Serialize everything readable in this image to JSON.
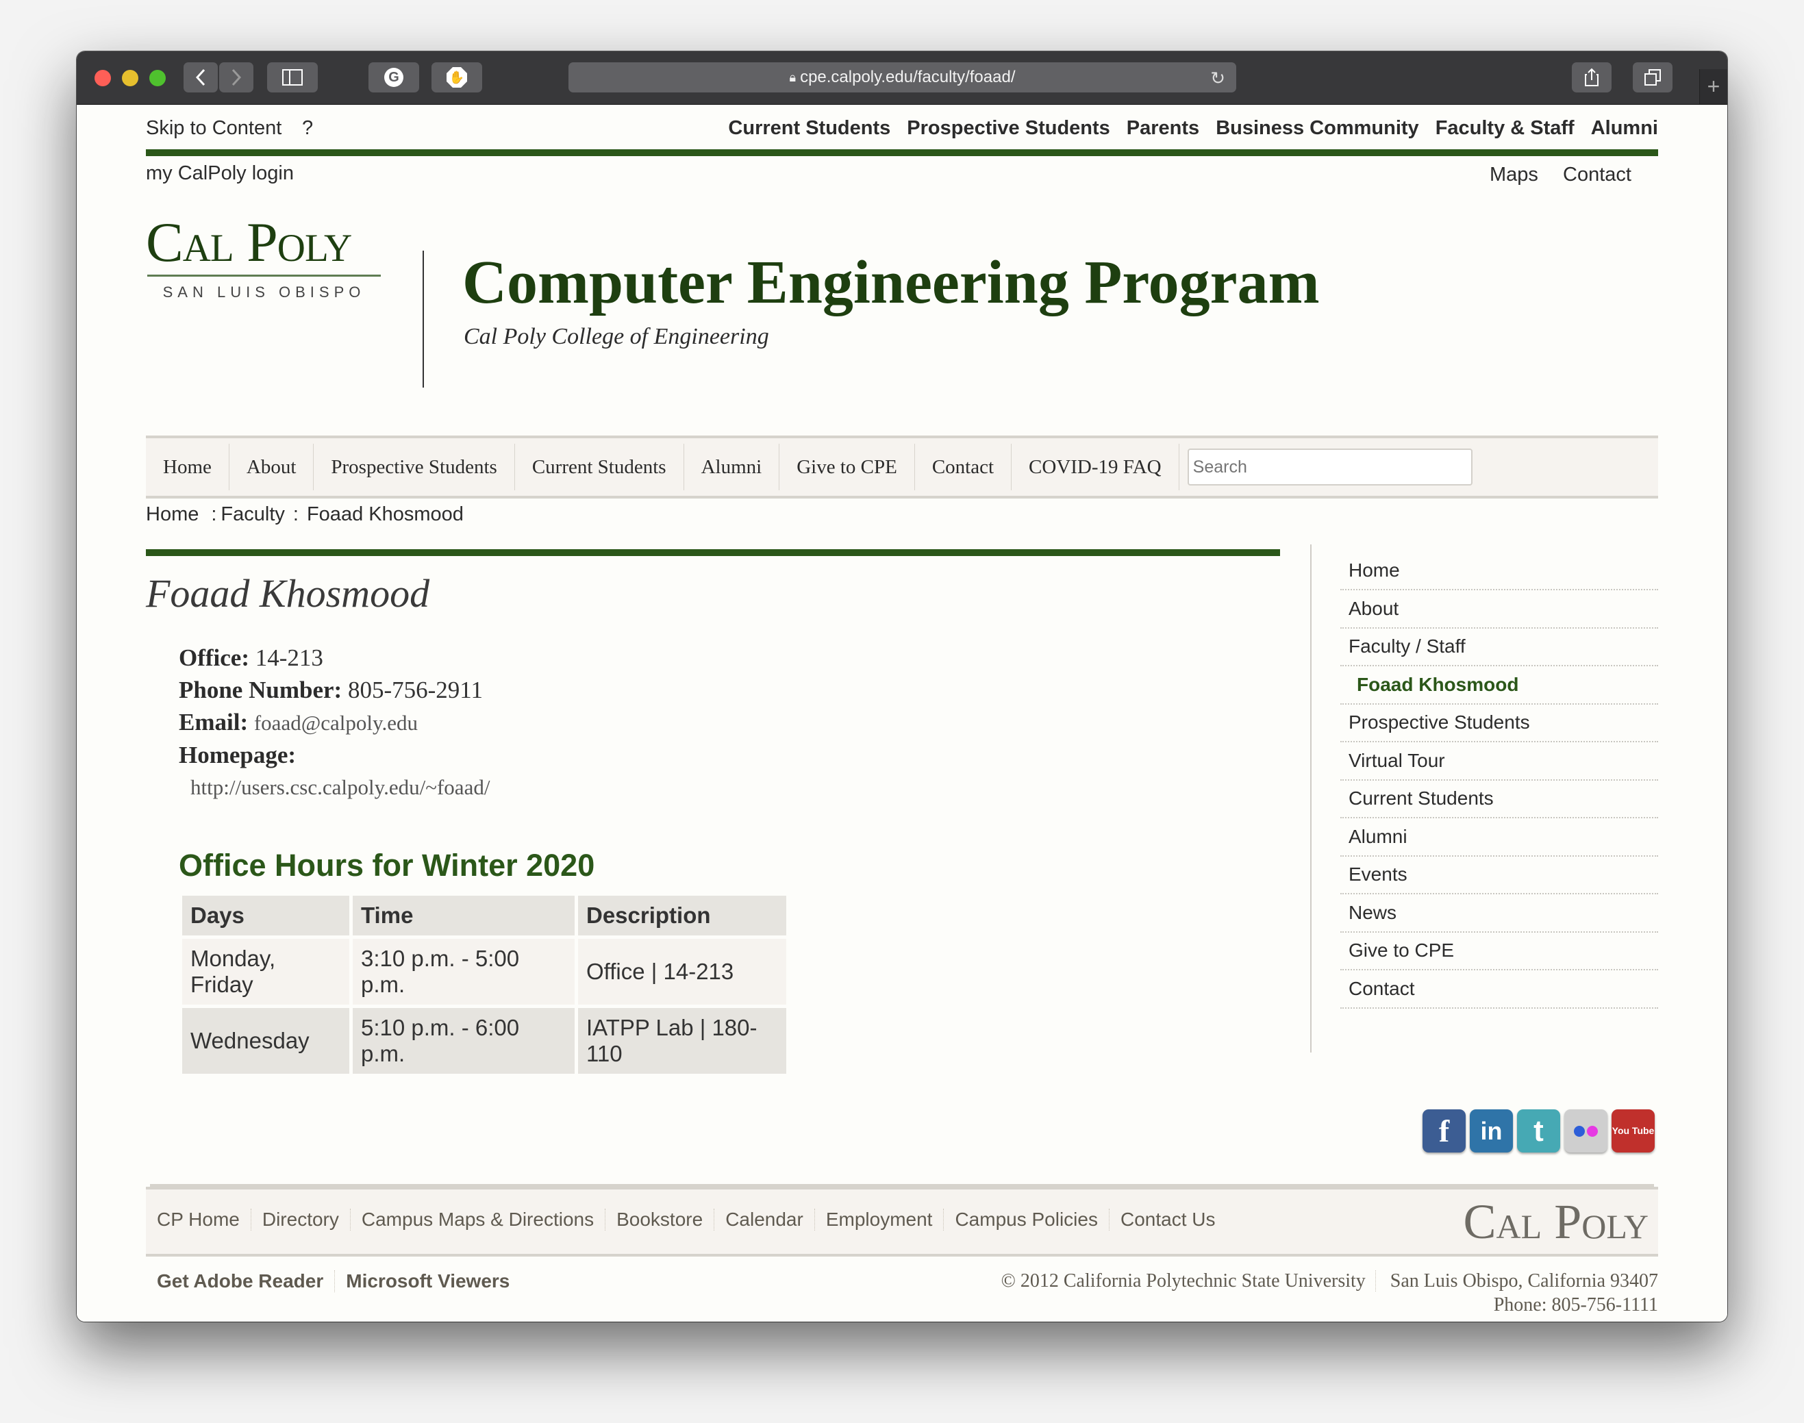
{
  "browser": {
    "url": "cpe.calpoly.edu/faculty/foaad/",
    "icons": [
      "back-icon",
      "forward-icon",
      "sidebar-icon",
      "grammarly-icon",
      "adblock-icon",
      "lock-icon",
      "reload-icon",
      "share-icon",
      "tabs-icon",
      "new-tab-icon"
    ]
  },
  "utility": {
    "skip": "Skip to Content",
    "help": "?",
    "audience_links": [
      "Current Students",
      "Prospective Students",
      "Parents",
      "Business Community",
      "Faculty & Staff",
      "Alumni"
    ],
    "login": "my CalPoly login",
    "maps": "Maps",
    "contact": "Contact"
  },
  "header": {
    "logo_main": "Cal Poly",
    "logo_sub": "SAN LUIS OBISPO",
    "title": "Computer Engineering Program",
    "subtitle": "Cal Poly College of Engineering"
  },
  "nav": {
    "items": [
      "Home",
      "About",
      "Prospective Students",
      "Current Students",
      "Alumni",
      "Give to CPE",
      "Contact",
      "COVID-19 FAQ"
    ],
    "search_placeholder": "Search"
  },
  "breadcrumb": {
    "home": "Home",
    "sep": ":",
    "faculty": "Faculty",
    "current": "Foaad Khosmood"
  },
  "profile": {
    "name": "Foaad Khosmood",
    "office_label": "Office:",
    "office": "14-213",
    "phone_label": "Phone Number:",
    "phone": "805-756-2911",
    "email_label": "Email:",
    "email": "foaad@calpoly.edu",
    "homepage_label": "Homepage:",
    "homepage": "http://users.csc.calpoly.edu/~foaad/"
  },
  "office_hours": {
    "title": "Office Hours for Winter 2020",
    "headers": [
      "Days",
      "Time",
      "Description"
    ],
    "rows": [
      [
        "Monday, Friday",
        "3:10 p.m. - 5:00 p.m.",
        "Office | 14-213"
      ],
      [
        "Wednesday",
        "5:10 p.m. - 6:00 p.m.",
        "IATPP Lab | 180-110"
      ]
    ]
  },
  "sidebar": {
    "items": [
      "Home",
      "About",
      "Faculty / Staff",
      "Foaad Khosmood",
      "Prospective Students",
      "Virtual Tour",
      "Current Students",
      "Alumni",
      "Events",
      "News",
      "Give to CPE",
      "Contact"
    ],
    "active": "Foaad Khosmood"
  },
  "social": [
    {
      "name": "facebook",
      "glyph": "f",
      "color": "#3c5d93"
    },
    {
      "name": "linkedin",
      "glyph": "in",
      "color": "#2f74a8"
    },
    {
      "name": "twitter",
      "glyph": "t",
      "color": "#46a9b4"
    },
    {
      "name": "flickr",
      "glyph": "••",
      "color": "#cfcfcf"
    },
    {
      "name": "youtube",
      "glyph": "You Tube",
      "color": "#c0302c"
    }
  ],
  "footer": {
    "links": [
      "CP Home",
      "Directory",
      "Campus Maps & Directions",
      "Bookstore",
      "Calendar",
      "Employment",
      "Campus Policies",
      "Contact Us"
    ],
    "logo": "Cal Poly",
    "secondary": [
      "Get Adobe Reader",
      "Microsoft Viewers"
    ],
    "copyright": "© 2012 California Polytechnic State University",
    "address": "San Luis Obispo, California 93407",
    "phone": "Phone: 805-756-1111"
  },
  "colors": {
    "brand_green": "#2b5719",
    "title_green": "#1e3f10"
  }
}
